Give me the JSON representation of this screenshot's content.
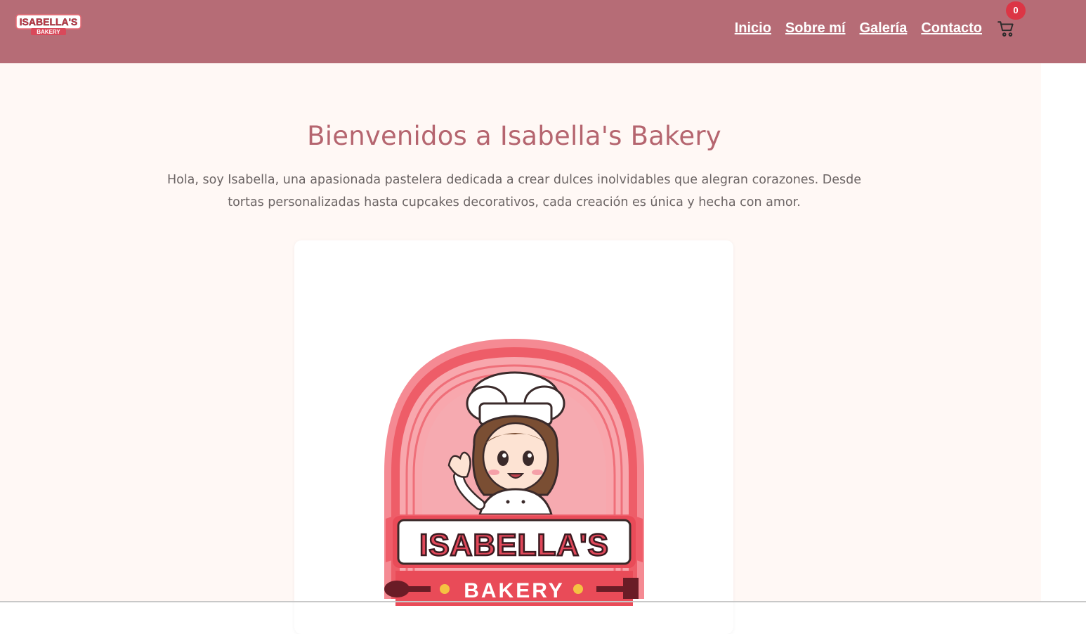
{
  "brand": {
    "logo_line1": "ISABELLA'S",
    "logo_line2": "BAKERY"
  },
  "nav": {
    "items": [
      {
        "label": "Inicio"
      },
      {
        "label": "Sobre mí"
      },
      {
        "label": "Galería"
      },
      {
        "label": "Contacto"
      }
    ],
    "cart_icon": "shopping-cart-icon",
    "cart_count": "0"
  },
  "hero": {
    "title": "Bienvenidos a Isabella's Bakery",
    "text": "Hola, soy Isabella, una apasionada pastelera dedicada a crear dulces inolvidables que alegran corazones. Desde tortas personalizadas hasta cupcakes decorativos, cada creación es única y hecha con amor."
  },
  "featured_logo": {
    "line1": "ISABELLA'S",
    "line2": "BAKERY"
  },
  "colors": {
    "navbar": "#b66c76",
    "title": "#b5656f",
    "background": "#fff8f5",
    "badge": "#dc3545"
  }
}
